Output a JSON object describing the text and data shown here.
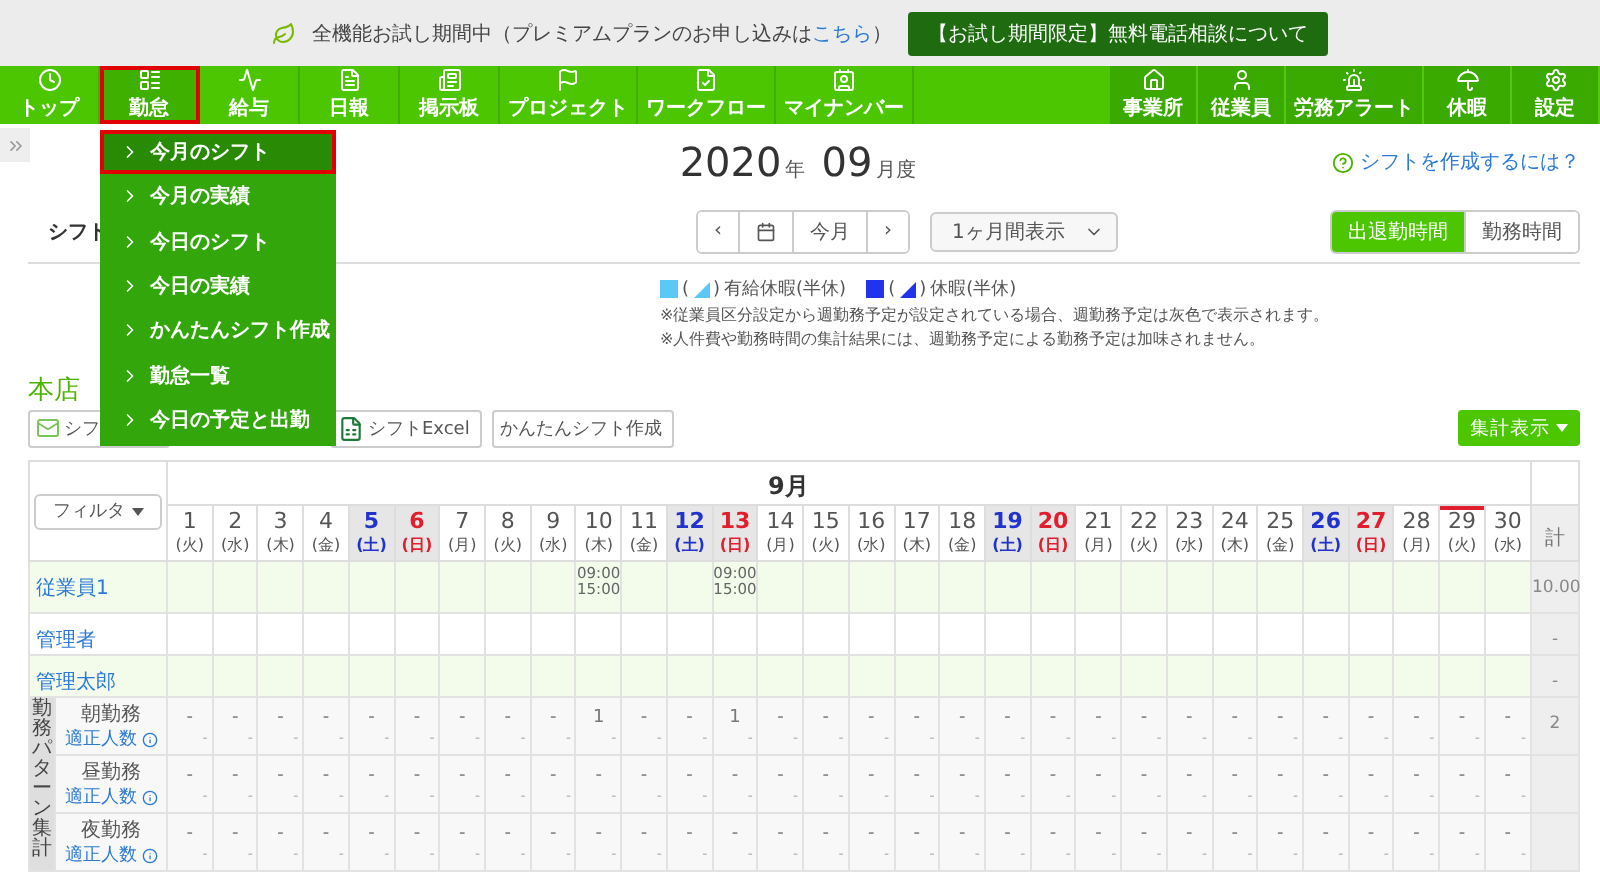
{
  "banner": {
    "text_before": "全機能お試し期間中（プレミアムプランのお申し込みは",
    "link": "こちら",
    "text_after": "）",
    "button": "【お試し期間限定】無料電話相談について"
  },
  "nav": {
    "left": [
      {
        "label": "トップ",
        "selected": false
      },
      {
        "label": "勤怠",
        "selected": true
      },
      {
        "label": "給与",
        "selected": false
      },
      {
        "label": "日報",
        "selected": false
      },
      {
        "label": "掲示板",
        "selected": false
      },
      {
        "label": "プロジェクト",
        "selected": false
      },
      {
        "label": "ワークフロー",
        "selected": false
      },
      {
        "label": "マイナンバー",
        "selected": false
      }
    ],
    "right": [
      {
        "label": "事業所",
        "selected": false
      },
      {
        "label": "従業員",
        "selected": false
      },
      {
        "label": "労務アラート",
        "selected": false
      },
      {
        "label": "休暇",
        "selected": false
      },
      {
        "label": "設定",
        "selected": false
      }
    ]
  },
  "dropdown": [
    {
      "label": "今月のシフト",
      "selected": true
    },
    {
      "label": "今月の実績",
      "selected": false
    },
    {
      "label": "今日のシフト",
      "selected": false
    },
    {
      "label": "今日の実績",
      "selected": false
    },
    {
      "label": "かんたんシフト作成",
      "selected": false
    },
    {
      "label": "勤怠一覧",
      "selected": false
    },
    {
      "label": "今日の予定と出勤",
      "selected": false
    }
  ],
  "title": {
    "year": "2020",
    "year_unit": "年",
    "month": "09",
    "month_unit": "月度"
  },
  "help_link": "シフトを作成するには？",
  "tab": "シフト",
  "period_nav": {
    "today": "今月",
    "prev": "‹",
    "next": "›"
  },
  "range_select": "1ヶ月間表示",
  "view_toggle": [
    {
      "label": "出退勤時間",
      "selected": true
    },
    {
      "label": "勤務時間",
      "selected": false
    }
  ],
  "legend": {
    "items": [
      {
        "color": "#5bc8f5",
        "label": "有給休暇(半休)",
        "open": "(",
        "close": ")"
      },
      {
        "color": "#2233ee",
        "label": "休暇(半休)",
        "open": "(",
        "close": ")"
      }
    ],
    "notes": [
      "※従業員区分設定から週勤務予定が設定されている場合、週勤務予定は灰色で表示されます。",
      "※人件費や勤務時間の集計結果には、週勤務予定による勤務予定は加味されません。"
    ]
  },
  "section_title": "本店",
  "actions": [
    {
      "label": "シフ",
      "kind": "mail"
    },
    {
      "label": "シフトExcel",
      "kind": "excel"
    },
    {
      "label": "かんたんシフト作成",
      "kind": "plain"
    }
  ],
  "summary_button": "集計表示",
  "table": {
    "filter": "フィルタ",
    "month": "9月",
    "total_header": "計",
    "days": [
      {
        "day": "1",
        "weekday": "(火)",
        "kind": "weekday",
        "today": false
      },
      {
        "day": "2",
        "weekday": "(水)",
        "kind": "weekday",
        "today": false
      },
      {
        "day": "3",
        "weekday": "(木)",
        "kind": "weekday",
        "today": false
      },
      {
        "day": "4",
        "weekday": "(金)",
        "kind": "weekday",
        "today": false
      },
      {
        "day": "5",
        "weekday": "(土)",
        "kind": "sat",
        "today": false
      },
      {
        "day": "6",
        "weekday": "(日)",
        "kind": "sun",
        "today": false
      },
      {
        "day": "7",
        "weekday": "(月)",
        "kind": "weekday",
        "today": false
      },
      {
        "day": "8",
        "weekday": "(火)",
        "kind": "weekday",
        "today": false
      },
      {
        "day": "9",
        "weekday": "(水)",
        "kind": "weekday",
        "today": false
      },
      {
        "day": "10",
        "weekday": "(木)",
        "kind": "weekday",
        "today": false
      },
      {
        "day": "11",
        "weekday": "(金)",
        "kind": "weekday",
        "today": false
      },
      {
        "day": "12",
        "weekday": "(土)",
        "kind": "sat",
        "today": false
      },
      {
        "day": "13",
        "weekday": "(日)",
        "kind": "sun",
        "today": false
      },
      {
        "day": "14",
        "weekday": "(月)",
        "kind": "weekday",
        "today": false
      },
      {
        "day": "15",
        "weekday": "(火)",
        "kind": "weekday",
        "today": false
      },
      {
        "day": "16",
        "weekday": "(水)",
        "kind": "weekday",
        "today": false
      },
      {
        "day": "17",
        "weekday": "(木)",
        "kind": "weekday",
        "today": false
      },
      {
        "day": "18",
        "weekday": "(金)",
        "kind": "weekday",
        "today": false
      },
      {
        "day": "19",
        "weekday": "(土)",
        "kind": "sat",
        "today": false
      },
      {
        "day": "20",
        "weekday": "(日)",
        "kind": "sun",
        "today": false
      },
      {
        "day": "21",
        "weekday": "(月)",
        "kind": "weekday",
        "today": false
      },
      {
        "day": "22",
        "weekday": "(火)",
        "kind": "weekday",
        "today": false
      },
      {
        "day": "23",
        "weekday": "(水)",
        "kind": "weekday",
        "today": false
      },
      {
        "day": "24",
        "weekday": "(木)",
        "kind": "weekday",
        "today": false
      },
      {
        "day": "25",
        "weekday": "(金)",
        "kind": "weekday",
        "today": false
      },
      {
        "day": "26",
        "weekday": "(土)",
        "kind": "sat",
        "today": false
      },
      {
        "day": "27",
        "weekday": "(日)",
        "kind": "sun",
        "today": false
      },
      {
        "day": "28",
        "weekday": "(月)",
        "kind": "weekday",
        "today": false
      },
      {
        "day": "29",
        "weekday": "(火)",
        "kind": "weekday",
        "today": true
      },
      {
        "day": "30",
        "weekday": "(水)",
        "kind": "weekday",
        "today": false
      }
    ],
    "employees": [
      {
        "name": "従業員1",
        "total": "10.00",
        "shifts": [
          {
            "kind": "empty"
          },
          {
            "kind": "empty"
          },
          {
            "kind": "empty"
          },
          {
            "kind": "empty"
          },
          {
            "kind": "empty"
          },
          {
            "kind": "empty"
          },
          {
            "kind": "empty"
          },
          {
            "kind": "empty"
          },
          {
            "kind": "empty"
          },
          {
            "kind": "shift",
            "start": "09:00",
            "end": "15:00"
          },
          {
            "kind": "empty"
          },
          {
            "kind": "empty"
          },
          {
            "kind": "shift",
            "start": "09:00",
            "end": "15:00"
          },
          {
            "kind": "empty"
          },
          {
            "kind": "empty"
          },
          {
            "kind": "empty"
          },
          {
            "kind": "empty"
          },
          {
            "kind": "empty"
          },
          {
            "kind": "empty"
          },
          {
            "kind": "empty"
          },
          {
            "kind": "empty"
          },
          {
            "kind": "empty"
          },
          {
            "kind": "empty"
          },
          {
            "kind": "empty"
          },
          {
            "kind": "empty"
          },
          {
            "kind": "empty"
          },
          {
            "kind": "empty"
          },
          {
            "kind": "empty"
          },
          {
            "kind": "empty"
          },
          {
            "kind": "empty"
          }
        ]
      },
      {
        "name": "管理者",
        "total": "-",
        "shifts": [
          {
            "kind": "empty"
          },
          {
            "kind": "empty"
          },
          {
            "kind": "empty"
          },
          {
            "kind": "empty"
          },
          {
            "kind": "empty"
          },
          {
            "kind": "empty"
          },
          {
            "kind": "empty"
          },
          {
            "kind": "empty"
          },
          {
            "kind": "empty"
          },
          {
            "kind": "empty"
          },
          {
            "kind": "empty"
          },
          {
            "kind": "empty"
          },
          {
            "kind": "empty"
          },
          {
            "kind": "empty"
          },
          {
            "kind": "empty"
          },
          {
            "kind": "empty"
          },
          {
            "kind": "empty"
          },
          {
            "kind": "empty"
          },
          {
            "kind": "empty"
          },
          {
            "kind": "empty"
          },
          {
            "kind": "empty"
          },
          {
            "kind": "empty"
          },
          {
            "kind": "empty"
          },
          {
            "kind": "empty"
          },
          {
            "kind": "empty"
          },
          {
            "kind": "empty"
          },
          {
            "kind": "empty"
          },
          {
            "kind": "empty"
          },
          {
            "kind": "empty"
          },
          {
            "kind": "empty"
          }
        ]
      },
      {
        "name": "管理太郎",
        "total": "-",
        "shifts": [
          {
            "kind": "empty"
          },
          {
            "kind": "empty"
          },
          {
            "kind": "empty"
          },
          {
            "kind": "empty"
          },
          {
            "kind": "empty"
          },
          {
            "kind": "empty"
          },
          {
            "kind": "empty"
          },
          {
            "kind": "empty"
          },
          {
            "kind": "empty"
          },
          {
            "kind": "empty"
          },
          {
            "kind": "empty"
          },
          {
            "kind": "empty"
          },
          {
            "kind": "empty"
          },
          {
            "kind": "empty"
          },
          {
            "kind": "empty"
          },
          {
            "kind": "empty"
          },
          {
            "kind": "empty"
          },
          {
            "kind": "empty"
          },
          {
            "kind": "empty"
          },
          {
            "kind": "empty"
          },
          {
            "kind": "empty"
          },
          {
            "kind": "empty"
          },
          {
            "kind": "empty"
          },
          {
            "kind": "empty"
          },
          {
            "kind": "empty"
          },
          {
            "kind": "empty"
          },
          {
            "kind": "empty"
          },
          {
            "kind": "empty"
          },
          {
            "kind": "empty"
          },
          {
            "kind": "empty"
          }
        ]
      }
    ],
    "pattern_group": "勤務パターン集計",
    "patterns": [
      {
        "name": "朝勤務",
        "sub": "適正人数",
        "total": "2",
        "counts": [
          "-",
          "-",
          "-",
          "-",
          "-",
          "-",
          "-",
          "-",
          "-",
          "1",
          "-",
          "-",
          "1",
          "-",
          "-",
          "-",
          "-",
          "-",
          "-",
          "-",
          "-",
          "-",
          "-",
          "-",
          "-",
          "-",
          "-",
          "-",
          "-",
          "-"
        ],
        "targets": [
          "-",
          "-",
          "-",
          "-",
          "-",
          "-",
          "-",
          "-",
          "-",
          "-",
          "-",
          "-",
          "-",
          "-",
          "-",
          "-",
          "-",
          "-",
          "-",
          "-",
          "-",
          "-",
          "-",
          "-",
          "-",
          "-",
          "-",
          "-",
          "-",
          "-"
        ]
      },
      {
        "name": "昼勤務",
        "sub": "適正人数",
        "counts": [
          "-",
          "-",
          "-",
          "-",
          "-",
          "-",
          "-",
          "-",
          "-",
          "-",
          "-",
          "-",
          "-",
          "-",
          "-",
          "-",
          "-",
          "-",
          "-",
          "-",
          "-",
          "-",
          "-",
          "-",
          "-",
          "-",
          "-",
          "-",
          "-",
          "-"
        ],
        "targets": [
          "-",
          "-",
          "-",
          "-",
          "-",
          "-",
          "-",
          "-",
          "-",
          "-",
          "-",
          "-",
          "-",
          "-",
          "-",
          "-",
          "-",
          "-",
          "-",
          "-",
          "-",
          "-",
          "-",
          "-",
          "-",
          "-",
          "-",
          "-",
          "-",
          "-"
        ]
      },
      {
        "name": "夜勤務",
        "sub": "適正人数",
        "counts": [
          "-",
          "-",
          "-",
          "-",
          "-",
          "-",
          "-",
          "-",
          "-",
          "-",
          "-",
          "-",
          "-",
          "-",
          "-",
          "-",
          "-",
          "-",
          "-",
          "-",
          "-",
          "-",
          "-",
          "-",
          "-",
          "-",
          "-",
          "-",
          "-",
          "-"
        ],
        "targets": [
          "-",
          "-",
          "-",
          "-",
          "-",
          "-",
          "-",
          "-",
          "-",
          "-",
          "-",
          "-",
          "-",
          "-",
          "-",
          "-",
          "-",
          "-",
          "-",
          "-",
          "-",
          "-",
          "-",
          "-",
          "-",
          "-",
          "-",
          "-",
          "-",
          "-"
        ]
      }
    ]
  }
}
